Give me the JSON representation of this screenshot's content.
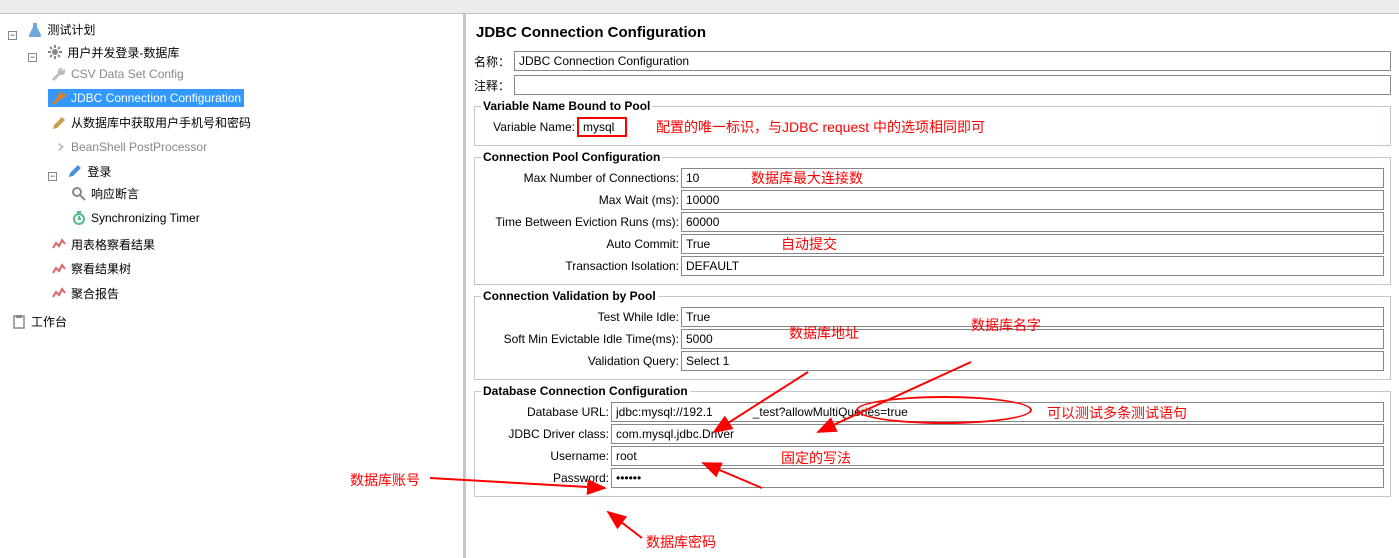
{
  "tree": {
    "root": "测试计划",
    "group": "用户并发登录-数据库",
    "items": {
      "csv": "CSV Data Set Config",
      "jdbc": "JDBC Connection Configuration",
      "dbquery": "从数据库中获取用户手机号和密码",
      "beanshell": "BeanShell PostProcessor",
      "login": "登录",
      "assert": "响应断言",
      "sync": "Synchronizing Timer",
      "tableResult": "用表格察看结果",
      "treeResult": "察看结果树",
      "aggregate": "聚合报告"
    },
    "workbench": "工作台"
  },
  "panel": {
    "title": "JDBC Connection Configuration",
    "nameLabel": "名称：",
    "nameValue": "JDBC Connection Configuration",
    "commentLabel": "注释："
  },
  "varSection": {
    "legend": "Variable Name Bound to Pool",
    "label": "Variable Name:",
    "value": "mysql"
  },
  "poolSection": {
    "legend": "Connection Pool Configuration",
    "maxConnLabel": "Max Number of Connections:",
    "maxConnValue": "10",
    "maxWaitLabel": "Max Wait (ms):",
    "maxWaitValue": "10000",
    "evictLabel": "Time Between Eviction Runs (ms):",
    "evictValue": "60000",
    "autoCommitLabel": "Auto Commit:",
    "autoCommitValue": "True",
    "txIsoLabel": "Transaction Isolation:",
    "txIsoValue": "DEFAULT"
  },
  "validSection": {
    "legend": "Connection Validation by Pool",
    "testIdleLabel": "Test While Idle:",
    "testIdleValue": "True",
    "softMinLabel": "Soft Min Evictable Idle Time(ms):",
    "softMinValue": "5000",
    "validQueryLabel": "Validation Query:",
    "validQueryValue": "Select 1"
  },
  "dbSection": {
    "legend": "Database Connection Configuration",
    "urlLabel": "Database URL:",
    "urlValuePart1": "jdbc:mysql://192.1",
    "urlValuePart2": "_test?allowMultiQueries=true",
    "driverLabel": "JDBC Driver class:",
    "driverValue": "com.mysql.jdbc.Driver",
    "userLabel": "Username:",
    "userValue": "root",
    "pwdLabel": "Password:",
    "pwdValue": "••••••"
  },
  "annotations": {
    "varHint": "配置的唯一标识，与JDBC request 中的选项相同即可",
    "maxConnHint": "数据库最大连接数",
    "autoCommitHint": "自动提交",
    "dbAddrHint": "数据库地址",
    "dbNameHint": "数据库名字",
    "allowMultiHint": "可以测试多条测试语句",
    "driverHint": "固定的写法",
    "userHint": "数据库账号",
    "pwdHint": "数据库密码"
  }
}
